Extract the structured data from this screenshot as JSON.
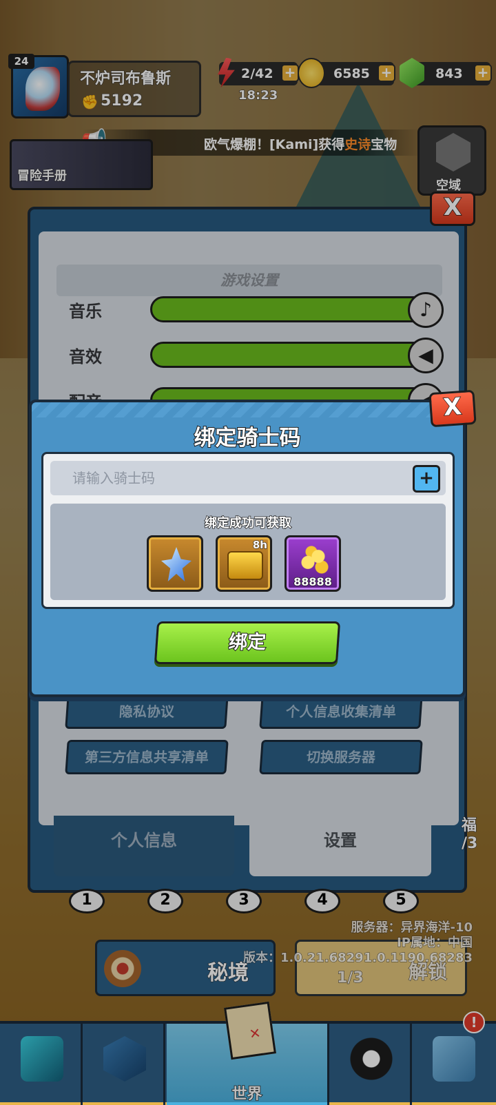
{
  "hud": {
    "level": "24",
    "player_name": "不炉司布鲁斯",
    "power": "5192",
    "energy": "2/42",
    "energy_timer": "18:23",
    "coins": "6585",
    "gems": "843",
    "ticker_prefix": "欧气爆棚！[Kami]获得",
    "ticker_highlight": "史诗",
    "ticker_suffix": "宝物",
    "guide_label": "冒险手册",
    "sky_label": "空域"
  },
  "settings": {
    "section_title": "游戏设置",
    "sliders": [
      {
        "label": "音乐",
        "level": 1.0,
        "icon": "music-note-icon"
      },
      {
        "label": "音效",
        "level": 1.0,
        "icon": "speaker-icon"
      },
      {
        "label": "配音",
        "level": 1.0,
        "icon": "speaker-icon"
      }
    ],
    "links": [
      "隐私协议",
      "个人信息收集清单",
      "第三方信息共享清单",
      "切换服务器"
    ],
    "tabs": {
      "personal": "个人信息",
      "settings": "设置"
    }
  },
  "bind_dialog": {
    "title": "绑定骑士码",
    "input_placeholder": "请输入骑士码",
    "reward_title": "绑定成功可获取",
    "rewards": [
      {
        "icon": "crystal-icon",
        "tag": "",
        "qty": ""
      },
      {
        "icon": "chest-icon",
        "tag": "8h",
        "qty": ""
      },
      {
        "icon": "gold-coins-icon",
        "tag": "",
        "qty": "88888"
      }
    ],
    "bind_label": "绑定"
  },
  "bottom": {
    "stages": [
      "1",
      "2",
      "3",
      "4",
      "5"
    ],
    "server_line": "服务器：异界海洋-10",
    "ip_line": "IP属地：中国",
    "version_line": "版本：1.0.21.68291.0.1190.68283",
    "secret_label": "秘境",
    "unlock_label": "解锁",
    "unlock_progress": "1/3",
    "fortune_label": "福",
    "fortune_progress": "/3",
    "nav_world": "世界",
    "nav_badge": "!"
  },
  "colors": {
    "accent_green": "#6cc41e",
    "panel_blue": "#4a93c6",
    "close_red": "#d8391d"
  }
}
